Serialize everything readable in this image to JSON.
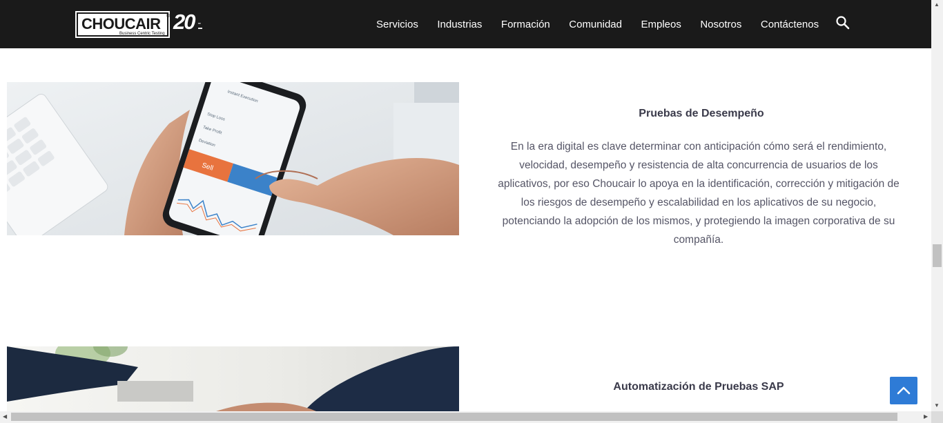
{
  "header": {
    "logo_text": "CHOUCAIR",
    "logo_tagline": "Business Centric Testing",
    "anniversary_number": "20",
    "nav": [
      "Servicios",
      "Industrias",
      "Formación",
      "Comunidad",
      "Empleos",
      "Nosotros",
      "Contáctenos"
    ],
    "search_icon": "search-icon"
  },
  "sections": [
    {
      "title": "Pruebas de Desempeño",
      "text": "En la era digital es clave determinar con anticipación cómo será el rendimiento, velocidad, desempeño y resistencia de alta concurrencia de usuarios de los aplicativos, por eso Choucair lo apoya en la identificación, corrección y mitigación de los riesgos de desempeño y escalabilidad en los aplicativos de su negocio, potenciando la adopción de los mismos, y protegiendo la imagen corporativa de su compañía."
    },
    {
      "title": "Automatización de Pruebas SAP"
    }
  ],
  "phone_screen": {
    "sell_label": "Sell",
    "labels": [
      "Instant Execution",
      "Stop Loss",
      "Take Profit",
      "Deviation"
    ]
  },
  "colors": {
    "header_bg": "#1a1a1a",
    "accent": "#2e7bd6",
    "title": "#3a3a4a",
    "text": "#555566"
  }
}
